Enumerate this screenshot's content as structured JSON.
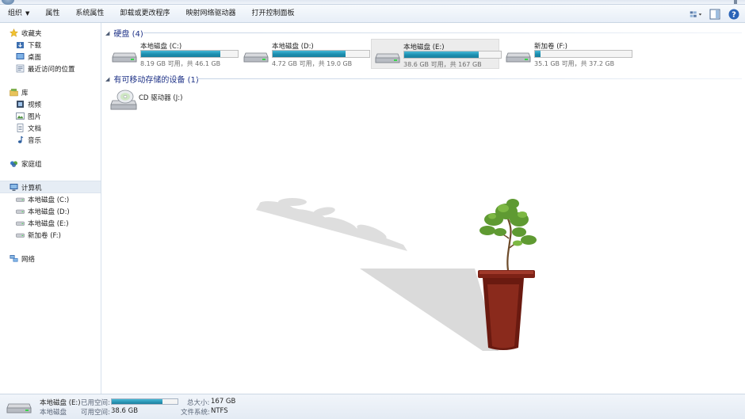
{
  "toolbar": {
    "organize": "组织",
    "properties": "属性",
    "system_properties": "系统属性",
    "uninstall": "卸载或更改程序",
    "map_drive": "映射网络驱动器",
    "control_panel": "打开控制面板",
    "right_icons": [
      "view-options-icon",
      "preview-pane-icon",
      "help-icon"
    ]
  },
  "sidebar": {
    "favorites": {
      "label": "收藏夹",
      "items": [
        "下载",
        "桌面",
        "最近访问的位置"
      ]
    },
    "libraries": {
      "label": "库",
      "items": [
        "视频",
        "图片",
        "文档",
        "音乐"
      ]
    },
    "homegroup": {
      "label": "家庭组"
    },
    "computer": {
      "label": "计算机",
      "items": [
        "本地磁盘 (C:)",
        "本地磁盘 (D:)",
        "本地磁盘 (E:)",
        "新加卷 (F:)"
      ]
    },
    "network": {
      "label": "网络"
    }
  },
  "hard_disks": {
    "header": "硬盘 (4)",
    "drives": [
      {
        "name": "本地磁盘 (C:)",
        "free": "8.19 GB 可用，共 46.1 GB",
        "used_fraction": 0.82
      },
      {
        "name": "本地磁盘 (D:)",
        "free": "4.72 GB 可用，共 19.0 GB",
        "used_fraction": 0.75
      },
      {
        "name": "本地磁盘 (E:)",
        "free": "38.6 GB 可用，共 167 GB",
        "used_fraction": 0.77
      },
      {
        "name": "新加卷 (F:)",
        "free": "35.1 GB 可用，共 37.2 GB",
        "used_fraction": 0.06
      }
    ]
  },
  "removable": {
    "header": "有可移动存储的设备 (1)",
    "devices": [
      {
        "name": "CD 驱动器 (J:)"
      }
    ]
  },
  "details": {
    "name": "本地磁盘 (E:)",
    "type": "本地磁盘",
    "used_label": "已用空间:",
    "free_label": "可用空间:",
    "free_value": "38.6 GB",
    "total_label": "总大小:",
    "total_value": "167 GB",
    "fs_label": "文件系统:",
    "fs_value": "NTFS",
    "used_fraction": 0.77
  },
  "colors": {
    "bar_fill": "#1c8fb0",
    "section_header": "#1e3287",
    "selected_tile": "#ececec"
  }
}
